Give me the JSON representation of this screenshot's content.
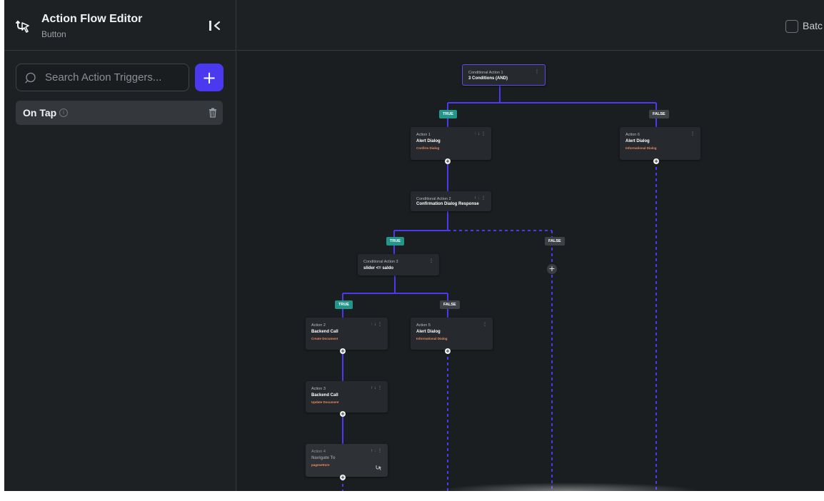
{
  "header": {
    "title": "Action Flow Editor",
    "subtitle": "Button"
  },
  "search": {
    "placeholder": "Search Action Triggers..."
  },
  "add_button_label": "+",
  "trigger": {
    "label": "On Tap"
  },
  "batch_label": "Batc",
  "nodes": {
    "cond1": {
      "label": "Conditional Action 1",
      "title": "3 Conditions (AND)"
    },
    "action1": {
      "label": "Action 1",
      "title": "Alert Dialog",
      "sub": "Confirm Dialog"
    },
    "action6": {
      "label": "Action 6",
      "title": "Alert Dialog",
      "sub": "Informational Dialog"
    },
    "cond2": {
      "label": "Conditional Action 2",
      "title": "Confirmation Dialog Response"
    },
    "cond3": {
      "label": "Conditional Action 3",
      "title": "slider <= saldo"
    },
    "action2": {
      "label": "Action 2",
      "title": "Backend Call",
      "sub": "Create Document"
    },
    "action5": {
      "label": "Action 5",
      "title": "Alert Dialog",
      "sub": "Informational Dialog"
    },
    "action3": {
      "label": "Action 3",
      "title": "Backend Call",
      "sub": "Update Document"
    },
    "action4": {
      "label": "Action 4",
      "title": "Navigate To",
      "sub": "pagesettore"
    }
  },
  "branches": {
    "true": "TRUE",
    "false": "FALSE"
  },
  "colors": {
    "accent": "#4b39ef",
    "true_badge": "#249689",
    "false_badge": "#3e4247",
    "subtitle_orange": "#ee8b60",
    "wire": "#4b39ef"
  },
  "icons": [
    "flow-icon",
    "collapse-icon",
    "search-icon",
    "plus-icon",
    "info-icon",
    "trash-icon",
    "kebab-icon",
    "arrow-up-icon",
    "arrow-down-icon",
    "navigate-icon"
  ]
}
